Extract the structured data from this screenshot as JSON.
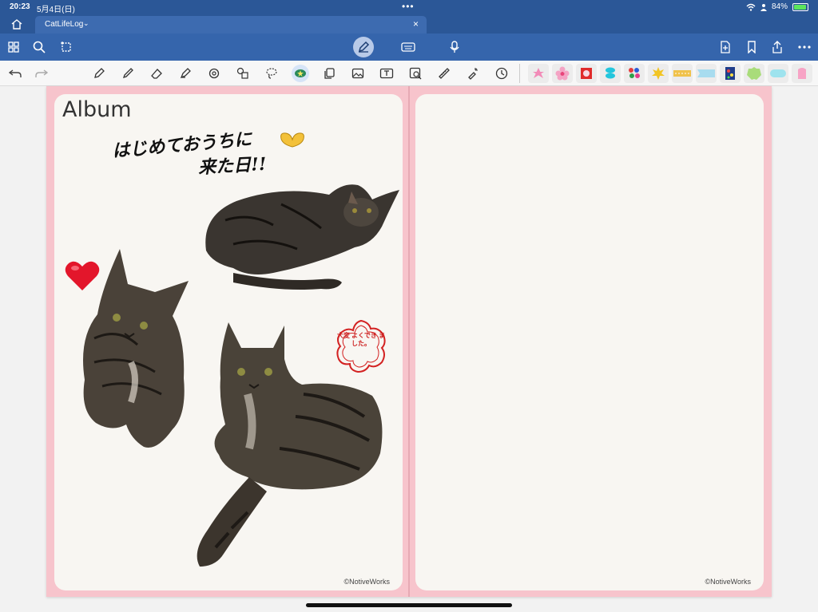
{
  "status": {
    "time": "20:23",
    "date": "5月4日(日)",
    "battery": "84%"
  },
  "tab": {
    "title": "CatLifeLog"
  },
  "page_left": {
    "title": "Album",
    "handwriting_line1": "はじめておうちに",
    "handwriting_line2": "来た日!!",
    "stamp_text": "大変 よくでき ました。",
    "copyright": "©NotiveWorks"
  },
  "page_right": {
    "copyright": "©NotiveWorks"
  },
  "colors": {
    "bar": "#2b5797",
    "toolbar": "#3565ac",
    "page_border": "#f7c4cc",
    "page_bg": "#f8f6f2"
  }
}
